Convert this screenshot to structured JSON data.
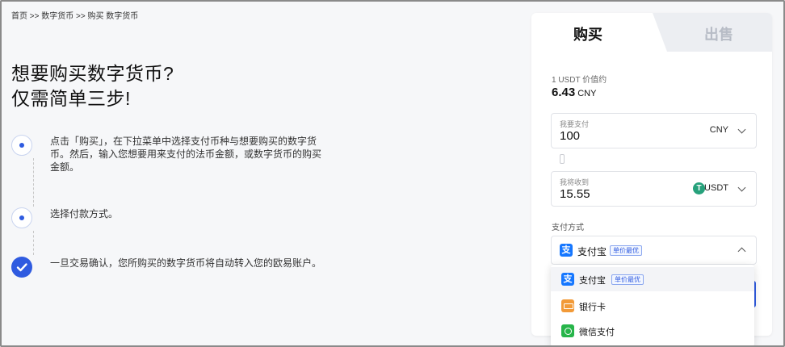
{
  "breadcrumb": "首页 >> 数字货币 >> 购买 数字货币",
  "headline": {
    "line1": "想要购买数字货币?",
    "line2": "仅需简单三步!"
  },
  "steps": [
    {
      "text": "点击「购买」，在下拉菜单中选择支付币种与想要购买的数字货币。然后，输入您想要用来支付的法币金额，或数字货币的购买金额。"
    },
    {
      "text": "选择付款方式。"
    },
    {
      "text": "一旦交易确认，您所购买的数字货币将自动转入您的欧易账户。"
    }
  ],
  "tabs": {
    "buy": "购买",
    "sell": "出售"
  },
  "rate": {
    "label": "1 USDT 价值约",
    "value": "6.43",
    "currency": "CNY"
  },
  "pay_field": {
    "label": "我要支付",
    "value": "100",
    "currency": "CNY"
  },
  "receive_field": {
    "label": "我将收到",
    "value": "15.55",
    "currency": "USDT",
    "icon": "tether-icon"
  },
  "payment": {
    "label": "支付方式",
    "selected": "支付宝",
    "selected_badge": "单价最优",
    "options": [
      {
        "name": "支付宝",
        "badge": "单价最优",
        "icon": "alipay-icon"
      },
      {
        "name": "银行卡",
        "icon": "bank-card-icon"
      },
      {
        "name": "微信支付",
        "icon": "wechat-pay-icon"
      }
    ]
  },
  "colors": {
    "accent": "#2f5be0",
    "alipay": "#1677ff",
    "tether": "#26a17b",
    "bank": "#f29a38",
    "wechat": "#27b54a"
  }
}
